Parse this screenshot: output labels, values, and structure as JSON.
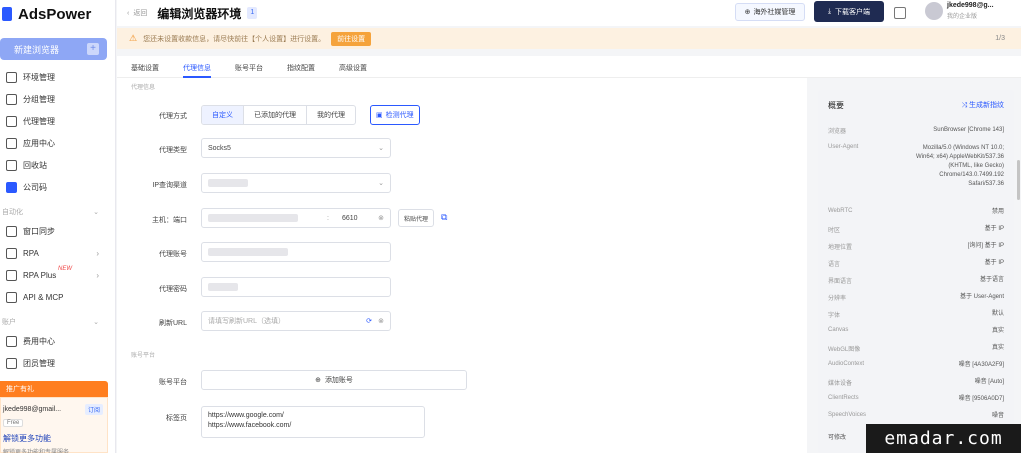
{
  "app": {
    "name": "AdsPower"
  },
  "sidebar": {
    "new_button": "新建浏览器",
    "items": [
      {
        "label": "环境管理",
        "icon": "window-icon"
      },
      {
        "label": "分组管理",
        "icon": "folder-icon"
      },
      {
        "label": "代理管理",
        "icon": "globe-icon"
      },
      {
        "label": "应用中心",
        "icon": "apps-icon"
      },
      {
        "label": "回收站",
        "icon": "trash-icon"
      },
      {
        "label": "公司码",
        "icon": "qr-icon"
      }
    ],
    "group1": "自动化",
    "items2": [
      {
        "label": "窗口同步",
        "icon": "sync-icon"
      },
      {
        "label": "RPA",
        "icon": "robot-icon"
      },
      {
        "label": "RPA Plus",
        "icon": "robot-plus-icon",
        "tag": "NEW"
      },
      {
        "label": "API & MCP",
        "icon": "api-icon"
      }
    ],
    "group2": "账户",
    "items3": [
      {
        "label": "费用中心",
        "icon": "wallet-icon"
      },
      {
        "label": "团员管理",
        "icon": "team-icon"
      }
    ],
    "promo": "推广有礼",
    "user": {
      "email": "jkede998@gmail...",
      "chip": "订阅",
      "plan": "Free",
      "upgrade": "解锁更多功能",
      "upgrade_sub": "解锁更多功能和专属服务"
    }
  },
  "header": {
    "back": "返回",
    "title": "编辑浏览器环境",
    "badge": "1",
    "btn_secondary": "海外社媒管理",
    "btn_primary": "下载客户端",
    "user_name": "jkede998@g...",
    "user_sub": "我的企业版"
  },
  "notice": {
    "text": "您还未设置收款信息，请尽快前往【个人设置】进行设置。",
    "button": "前往设置",
    "pager": "1/3"
  },
  "tabs": [
    "基础设置",
    "代理信息",
    "账号平台",
    "指纹配置",
    "高级设置"
  ],
  "active_tab": 1,
  "form": {
    "section_proxy": "代理信息",
    "proxy_mode_label": "代理方式",
    "proxy_modes": [
      "自定义",
      "已添加的代理",
      "我的代理"
    ],
    "proxy_mode_active": 0,
    "check_proxy": "检测代理",
    "proxy_type_label": "代理类型",
    "proxy_type_value": "Socks5",
    "ip_channel_label": "IP查询渠道",
    "host_label": "主机：端口",
    "port_value": "6610",
    "paste_btn": "粘贴代理",
    "account_label": "代理账号",
    "password_label": "代理密码",
    "refresh_url_label": "刷新URL",
    "refresh_url_placeholder": "请填写刷新URL（选填）",
    "section_platform": "账号平台",
    "platform_label": "账号平台",
    "add_account": "添加账号",
    "tabs_label": "标签页",
    "tabs_value": "https://www.google.com/\nhttps://www.facebook.com/"
  },
  "panel": {
    "title": "概要",
    "action": "生成新指纹",
    "rows": [
      {
        "k": "浏览器",
        "v": "SunBrowser [Chrome 143]"
      },
      {
        "k": "User-Agent",
        "v": "Mozilla/5.0 (Windows NT 10.0; Win64; x64) AppleWebKit/537.36 (KHTML, like Gecko) Chrome/143.0.7499.192 Safari/537.36"
      },
      {
        "k": "WebRTC",
        "v": "禁用"
      },
      {
        "k": "时区",
        "v": "基于 IP"
      },
      {
        "k": "地理位置",
        "v": "[询问] 基于 IP"
      },
      {
        "k": "语言",
        "v": "基于 IP"
      },
      {
        "k": "界面语言",
        "v": "基于语言"
      },
      {
        "k": "分辨率",
        "v": "基于 User-Agent"
      },
      {
        "k": "字体",
        "v": "默认"
      },
      {
        "k": "Canvas",
        "v": "真实"
      },
      {
        "k": "WebGL图像",
        "v": "真实"
      },
      {
        "k": "AudioContext",
        "v": "噪音 [4A30A2F9]"
      },
      {
        "k": "媒体设备",
        "v": "噪音 [Auto]"
      },
      {
        "k": "ClientRects",
        "v": "噪音 [9506A0D7]"
      },
      {
        "k": "SpeechVoices",
        "v": "噪音"
      }
    ],
    "footer": "可修改"
  },
  "watermark": "emadar.com"
}
